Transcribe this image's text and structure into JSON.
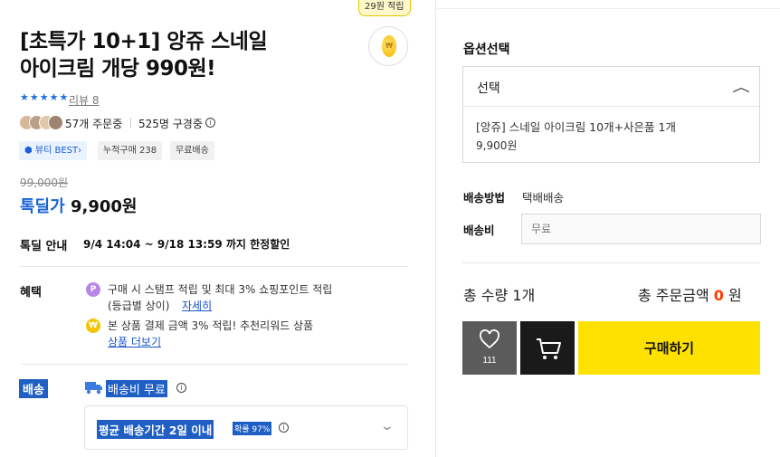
{
  "product": {
    "reward_badge": "29원 적립",
    "title_line1": "[초특가 10+1] 앙쥬 스네일",
    "title_line2": "아이크림 개당 990원!",
    "rating_stars": 5,
    "review_link": "리뷰 8",
    "buyers": "57개 주문중",
    "subscribers": "525명 구경중",
    "tags": [
      "뷰티 BEST",
      "누적구매 238",
      "무료배송"
    ],
    "original_price": "99,000원",
    "deal_label": "톡딜가",
    "deal_price": "9,900원",
    "deal_info_label": "톡딜 안내",
    "deal_info_text": "9/4 14:04 ~ 9/18 13:59 까지 한정할인"
  },
  "benefits": {
    "label": "혜택",
    "item1_line1": "구매 시 스탬프 적립 및 최대 3% 쇼핑포인트 적립",
    "item1_line2": "(등급별 상이)",
    "item1_link": "자세히",
    "item2_line1": "본 상품 결제 금액 3% 적립! 추천리워드 상품",
    "item2_link": "상품 더보기"
  },
  "shipping": {
    "label": "배송",
    "fee_text": "배송비 무료",
    "delivery_text": "평균 배송기간 2일 이내",
    "delivery_rate": "확률 97%"
  },
  "options": {
    "title": "옵션선택",
    "select_label": "선택",
    "item_name": "[앙쥬] 스네일 아이크림 10개+사은품 1개",
    "item_price": "9,900원"
  },
  "delivery_method": {
    "label": "배송방법",
    "value": "택배배송",
    "fee_label": "배송비",
    "fee_placeholder": "무료"
  },
  "totals": {
    "qty_text": "총 수량  1개",
    "amount_prefix": "총 주문금액 ",
    "amount_value": "0",
    "amount_suffix": " 원"
  },
  "actions": {
    "wish_count": "111",
    "buy_label": "구매하기"
  },
  "colors": {
    "accent_blue": "#1a64d6",
    "buy_yellow": "#ffe100",
    "price_red": "#ff3b00"
  }
}
